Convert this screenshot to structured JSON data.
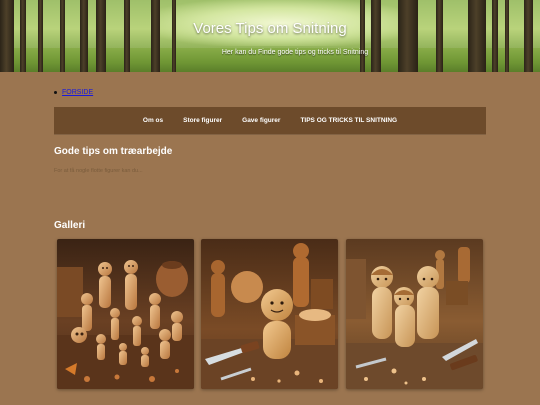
{
  "header": {
    "title": "Vores Tips om Snitning",
    "subtitle": "Her kan du Finde gode tips og tricks til Snitning"
  },
  "breadcrumb": {
    "label": "FORSIDE"
  },
  "nav": {
    "items": [
      "Om os",
      "Store figurer",
      "Gave figurer",
      "TIPS OG TRICKS TIL SNITNING"
    ]
  },
  "main": {
    "heading": "Gode tips om træarbejde",
    "intro": "For at få nogle flotte figurer kan du...",
    "gallery_heading": "Galleri"
  },
  "colors": {
    "page_bg": "#9b7550",
    "nav_bg": "#6d4b2b",
    "link": "#1a1adb"
  }
}
